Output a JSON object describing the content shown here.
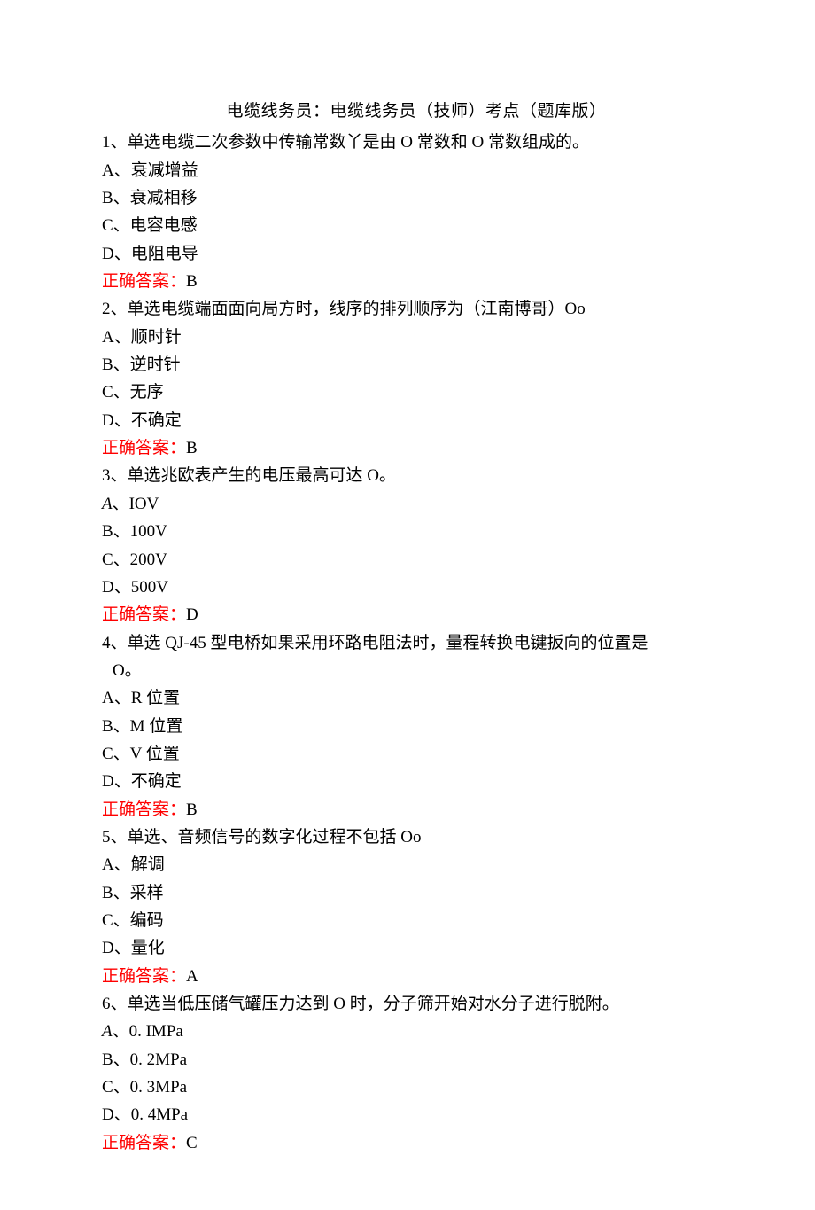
{
  "title": "电缆线务员：电缆线务员（技师）考点（题库版）",
  "questions": [
    {
      "stem": "1、单选电缆二次参数中传输常数丫是由 O 常数和 O 常数组成的。",
      "options": [
        "A、衰减增益",
        "B、衰减相移",
        "C、电容电感",
        "D、电阻电导"
      ],
      "answer_label": "正确答案：",
      "answer_value": "B"
    },
    {
      "stem": "2、单选电缆端面面向局方时，线序的排列顺序为（江南博哥）Oo",
      "options": [
        "A、顺时针",
        "B、逆时针",
        "C、无序",
        "D、不确定"
      ],
      "answer_label": "正确答案：",
      "answer_value": "B"
    },
    {
      "stem": "3、单选兆欧表产生的电压最高可达 O。",
      "options_special": [
        {
          "prefix_italic": "A",
          "rest": "、IOV"
        },
        {
          "prefix_italic": "",
          "rest": "B、100V"
        },
        {
          "prefix_italic": "",
          "rest": "C、200V"
        },
        {
          "prefix_italic": "",
          "rest": "D、500V"
        }
      ],
      "answer_label": "正确答案：",
      "answer_value": "D"
    },
    {
      "stem": "4、单选 QJ-45 型电桥如果采用环路电阻法时，量程转换电键扳向的位置是",
      "stem2_indent": "O。",
      "options": [
        "A、R 位置",
        "B、M 位置",
        "C、V 位置",
        "D、不确定"
      ],
      "answer_label": "正确答案：",
      "answer_value": "B"
    },
    {
      "stem": "5、单选、音频信号的数字化过程不包括 Oo",
      "options": [
        "A、解调",
        "B、采样",
        "C、编码",
        "D、量化"
      ],
      "answer_label": "正确答案：",
      "answer_value": "A"
    },
    {
      "stem": "6、单选当低压储气罐压力达到 O 时，分子筛开始对水分子进行脱附。",
      "options_special": [
        {
          "prefix_italic": "A",
          "rest": "、0. IMPa"
        },
        {
          "prefix_italic": "",
          "rest": "B、0. 2MPa"
        },
        {
          "prefix_italic": "",
          "rest": "C、0. 3MPa"
        },
        {
          "prefix_italic": "",
          "rest": "D、0. 4MPa"
        }
      ],
      "answer_label": "正确答案：",
      "answer_value": "C"
    }
  ]
}
